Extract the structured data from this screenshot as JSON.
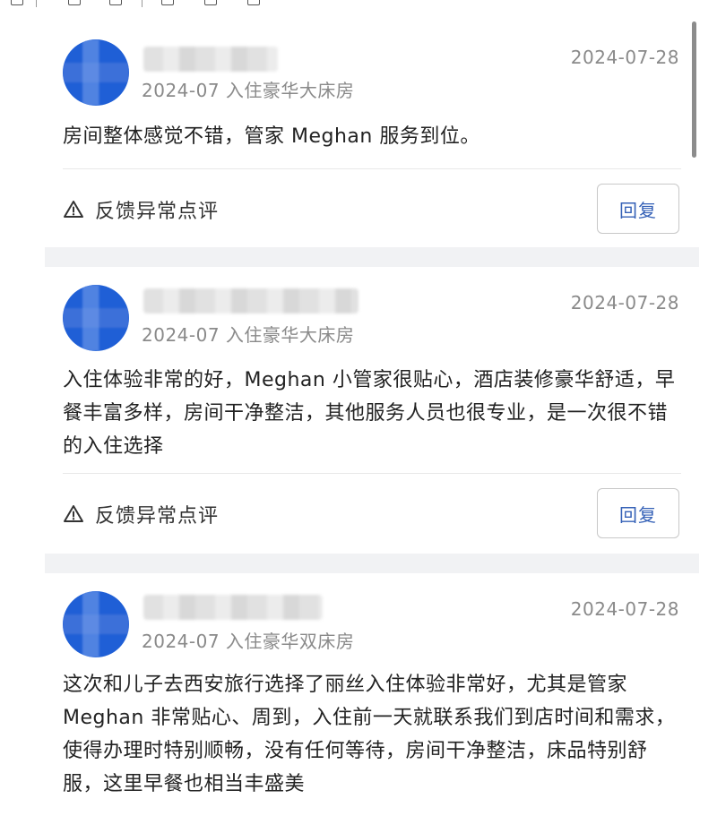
{
  "toolbar": {
    "icons": [
      "list-icon",
      "square-icon",
      "note-icon",
      "doc-icon",
      "image-icon",
      "frame-icon"
    ]
  },
  "reviews": [
    {
      "stay_info": "2024-07 入住豪华大床房",
      "date": "2024-07-28",
      "text": "房间整体感觉不错，管家 Meghan 服务到位。",
      "feedback_label": "反馈异常点评",
      "reply_label": "回复"
    },
    {
      "stay_info": "2024-07 入住豪华大床房",
      "date": "2024-07-28",
      "text": "入住体验非常的好，Meghan 小管家很贴心，酒店装修豪华舒适，早餐丰富多样，房间干净整洁，其他服务人员也很专业，是一次很不错的入住选择",
      "feedback_label": "反馈异常点评",
      "reply_label": "回复"
    },
    {
      "stay_info": "2024-07 入住豪华双床房",
      "date": "2024-07-28",
      "text": "这次和儿子去西安旅行选择了丽丝入住体验非常好，尤其是管家 Meghan 非常贴心、周到，入住前一天就联系我们到店时间和需求，使得办理时特别顺畅，没有任何等待，房间干净整洁，床品特别舒服，这里早餐也相当丰盛美",
      "feedback_label": "反馈异常点评",
      "reply_label": "回复"
    }
  ],
  "colors": {
    "avatar": "#1f5fd6",
    "reply_text": "#3561b7",
    "muted_text": "#8a8a8a",
    "band": "#f1f2f4"
  }
}
